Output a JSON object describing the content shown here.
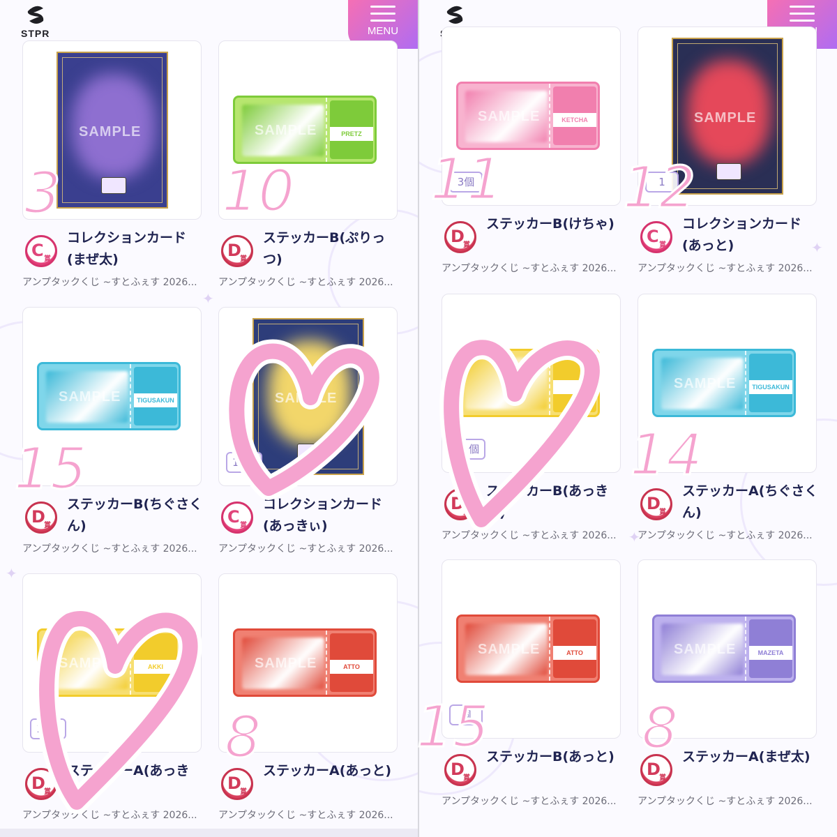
{
  "brand": {
    "logo_text": "STPR"
  },
  "menu": {
    "label": "MENU"
  },
  "panels": [
    {
      "id": "left",
      "cards": [
        {
          "prize": "C",
          "prize_suffix": "賞",
          "name": "コレクションカード(まぜ太)",
          "subtitle": "アンプタックくじ ~すとふぇす 2026...",
          "stock": "",
          "art": "card",
          "color": "#3a3f8f",
          "accent": "#8e6fd0",
          "ticket_label": "",
          "sample_text": "SAMPLE"
        },
        {
          "prize": "D",
          "prize_suffix": "賞",
          "name": "ステッカーB(ぷりっつ)",
          "subtitle": "アンプタックくじ ~すとふぇす 2026...",
          "stock": "",
          "art": "ticket",
          "color": "#7ecb3a",
          "accent": "#b7e66f",
          "ticket_label": "PRETZ",
          "sample_text": "SAMPLE"
        },
        {
          "prize": "D",
          "prize_suffix": "賞",
          "name": "ステッカーB(ちぐさくん)",
          "subtitle": "アンプタックくじ ~すとふぇす 2026...",
          "stock": "",
          "art": "ticket",
          "color": "#3cb9d8",
          "accent": "#7fd6ea",
          "ticket_label": "TIGUSAKUN",
          "sample_text": "SAMPLE"
        },
        {
          "prize": "C",
          "prize_suffix": "賞",
          "name": "コレクションカード(あっきぃ)",
          "subtitle": "アンプタックくじ ~すとふぇす 2026...",
          "stock": "19個",
          "art": "card",
          "color": "#2d3d7a",
          "accent": "#f2d66a",
          "ticket_label": "",
          "sample_text": "SAMPLE"
        },
        {
          "prize": "D",
          "prize_suffix": "賞",
          "name": "ステッカーA(あっきぃ)",
          "subtitle": "アンプタックくじ ~すとふぇす 2026...",
          "stock": "12個",
          "art": "ticket",
          "color": "#f2cc2c",
          "accent": "#f7df72",
          "ticket_label": "AKKI",
          "sample_text": "SAMPLE"
        },
        {
          "prize": "D",
          "prize_suffix": "賞",
          "name": "ステッカーA(あっと)",
          "subtitle": "アンプタックくじ ~すとふぇす 2026...",
          "stock": "",
          "art": "ticket",
          "color": "#e04a3a",
          "accent": "#f08072",
          "ticket_label": "ATTO",
          "sample_text": "SAMPLE"
        }
      ]
    },
    {
      "id": "right",
      "cards": [
        {
          "prize": "D",
          "prize_suffix": "賞",
          "name": "ステッカーB(けちゃ)",
          "subtitle": "アンプタックくじ ~すとふぇす 2026...",
          "stock": "3個",
          "art": "ticket",
          "color": "#f17fae",
          "accent": "#f8b3cf",
          "ticket_label": "KETCHA",
          "sample_text": "SAMPLE"
        },
        {
          "prize": "C",
          "prize_suffix": "賞",
          "name": "コレクションカード(あっと)",
          "subtitle": "アンプタックくじ ~すとふぇす 2026...",
          "stock": "1",
          "art": "card",
          "color": "#2a2f55",
          "accent": "#e5485a",
          "ticket_label": "",
          "sample_text": "SAMPLE"
        },
        {
          "prize": "D",
          "prize_suffix": "賞",
          "name": "ステッカーB(あっきぃ)",
          "subtitle": "アンプタックくじ ~すとふぇす 2026...",
          "stock": "11個",
          "art": "ticket",
          "color": "#f2cc2c",
          "accent": "#f7df72",
          "ticket_label": "",
          "sample_text": ""
        },
        {
          "prize": "D",
          "prize_suffix": "賞",
          "name": "ステッカーA(ちぐさくん)",
          "subtitle": "アンプタックくじ ~すとふぇす 2026...",
          "stock": "",
          "art": "ticket",
          "color": "#3cb9d8",
          "accent": "#7fd6ea",
          "ticket_label": "TIGUSAKUN",
          "sample_text": "SAMPLE"
        },
        {
          "prize": "D",
          "prize_suffix": "賞",
          "name": "ステッカーB(あっと)",
          "subtitle": "アンプタックくじ ~すとふぇす 2026...",
          "stock": "個",
          "art": "ticket",
          "color": "#e04a3a",
          "accent": "#f08072",
          "ticket_label": "ATTO",
          "sample_text": "SAMPLE"
        },
        {
          "prize": "D",
          "prize_suffix": "賞",
          "name": "ステッカーA(まぜ太)",
          "subtitle": "アンプタックくじ ~すとふぇす 2026...",
          "stock": "",
          "art": "ticket",
          "color": "#8f7fd6",
          "accent": "#bdb1ee",
          "ticket_label": "MAZETA",
          "sample_text": "SAMPLE"
        }
      ]
    }
  ],
  "annotations": {
    "color": "#f5a3cf",
    "numbers": [
      "3",
      "10",
      "15",
      "11",
      "12",
      "14",
      "15",
      "8",
      "8"
    ]
  }
}
